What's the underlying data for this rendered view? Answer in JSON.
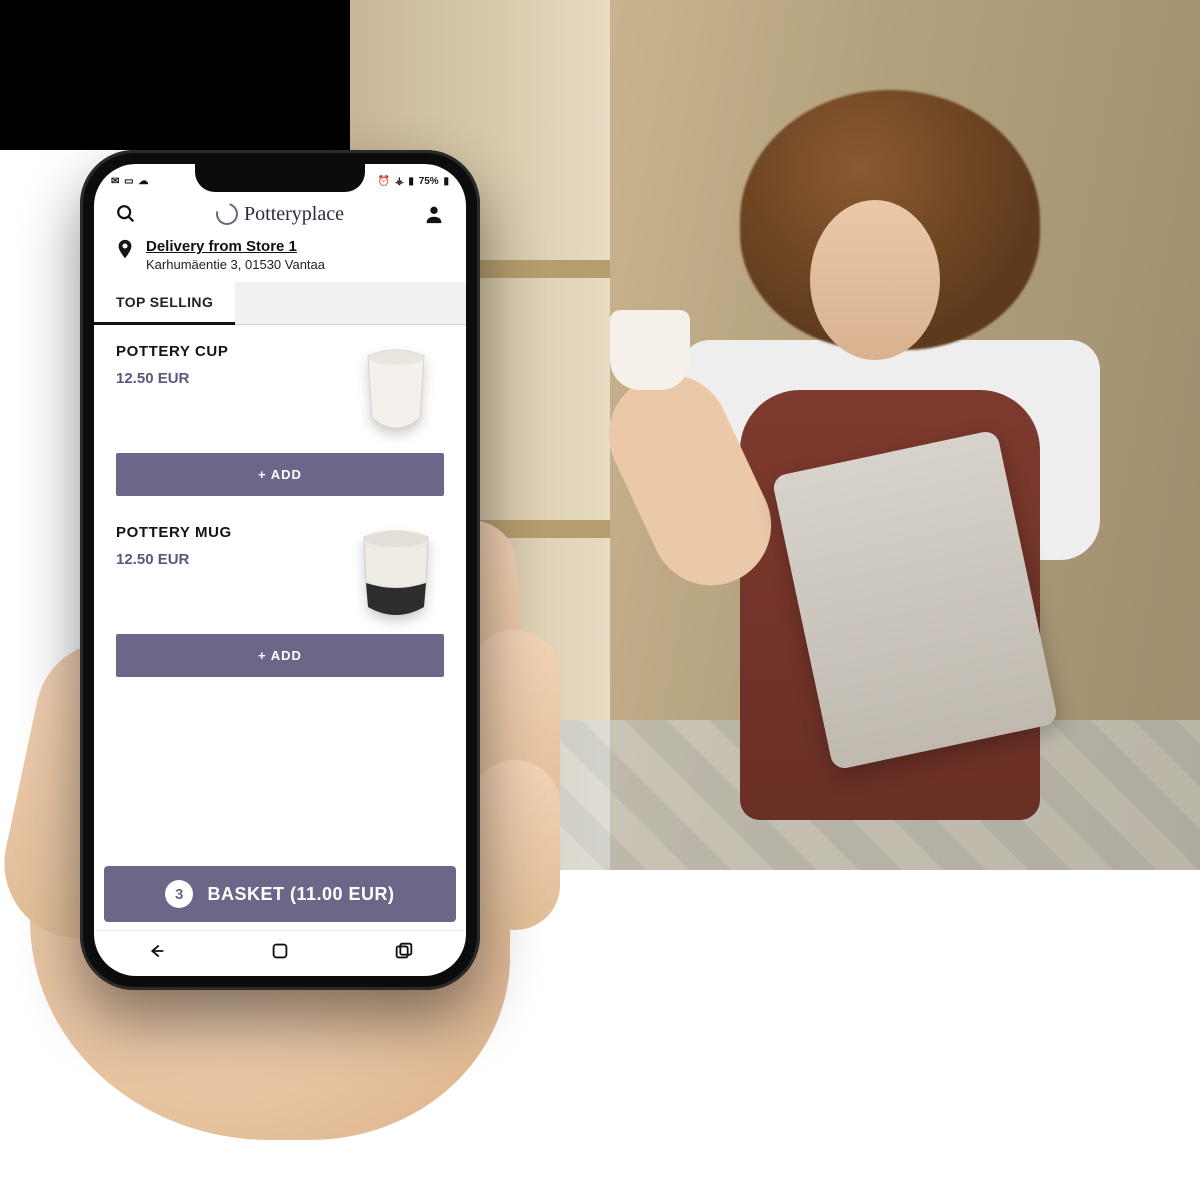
{
  "statusbar": {
    "battery": "75%"
  },
  "brand": {
    "name": "Potteryplace"
  },
  "delivery": {
    "title": "Delivery from Store 1",
    "address": "Karhumäentie 3, 01530 Vantaa"
  },
  "tabs": {
    "top_selling": "TOP SELLING"
  },
  "products": [
    {
      "name": "POTTERY CUP",
      "price": "12.50 EUR",
      "add_label": "+ ADD"
    },
    {
      "name": "POTTERY MUG",
      "price": "12.50 EUR",
      "add_label": "+ ADD"
    }
  ],
  "basket": {
    "count": "3",
    "label": "BASKET (11.00 EUR)"
  },
  "colors": {
    "accent": "#6e6689"
  }
}
